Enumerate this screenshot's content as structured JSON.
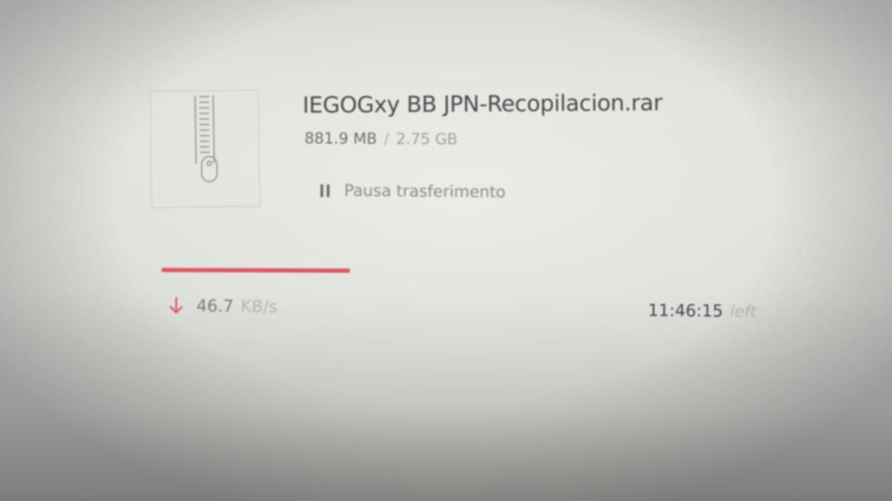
{
  "download": {
    "file_name": "IEGOGxy BB JPN-Recopilacion.rar",
    "file_icon": "archive-zipper-icon",
    "downloaded": "881.9 MB",
    "separator": "/",
    "total": "2.75 GB",
    "pause": {
      "icon": "pause-icon",
      "label": "Pausa trasferimento"
    },
    "progress_fraction": 0.26,
    "speed": {
      "icon": "arrow-down-icon",
      "value": "46.7",
      "unit": "KB/s"
    },
    "eta": {
      "time": "11:46:15",
      "suffix": "left"
    }
  },
  "colors": {
    "accent": "#e0565e",
    "text_primary": "#4a4c4a",
    "text_muted": "#a0a29e"
  }
}
